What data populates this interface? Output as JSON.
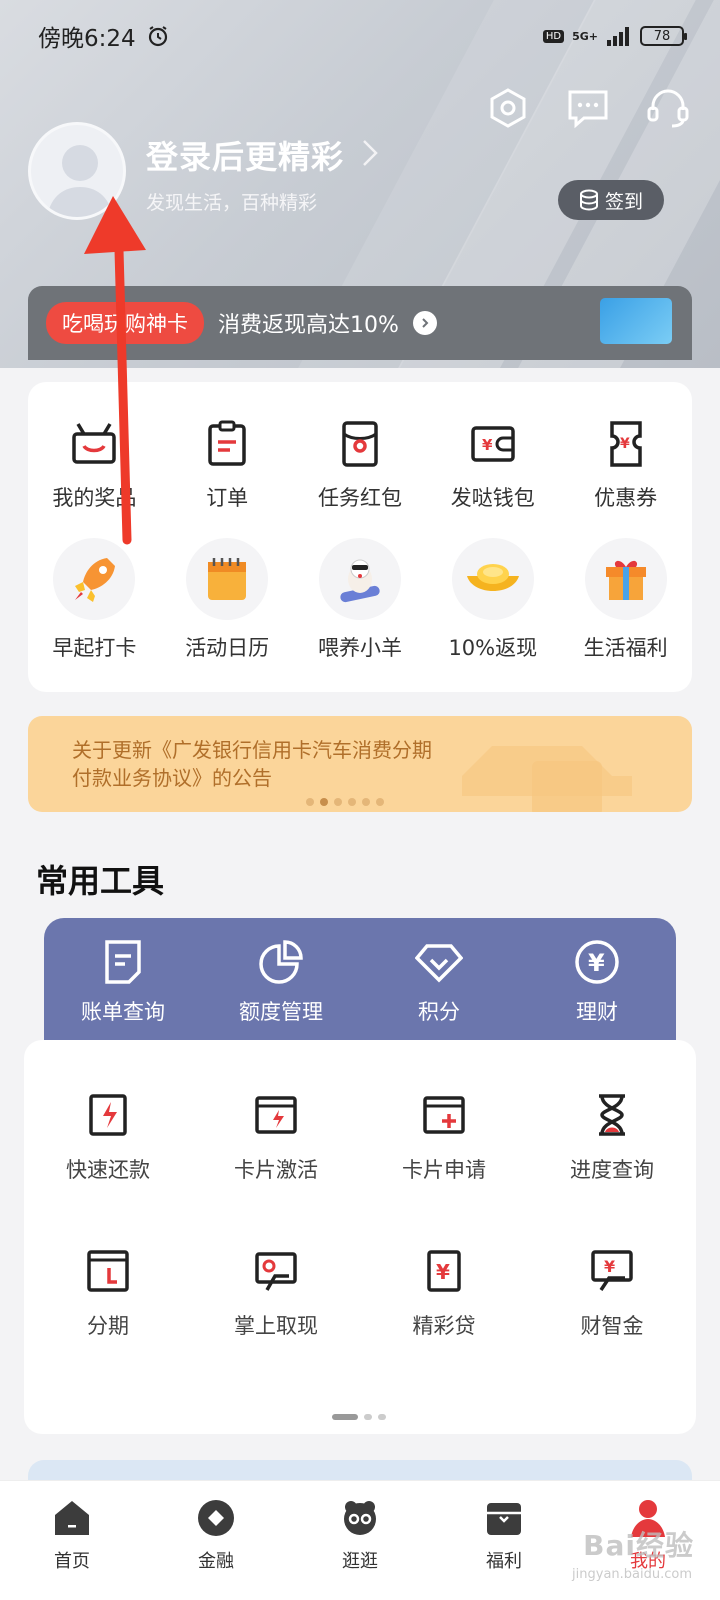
{
  "status_bar": {
    "time": "傍晚6:24",
    "hd": "HD",
    "network": "5G+",
    "battery": "78"
  },
  "header": {
    "login_title": "登录后更精彩",
    "login_subtitle": "发现生活，百种精彩",
    "checkin_label": "签到",
    "icons": [
      "settings-icon",
      "message-icon",
      "customer-service-icon"
    ]
  },
  "promo": {
    "tag": "吃喝玩购神卡",
    "text": "消费返现高达10%"
  },
  "quick_row1": [
    {
      "label": "我的奖品",
      "icon": "prize-basket-icon"
    },
    {
      "label": "订单",
      "icon": "order-clipboard-icon"
    },
    {
      "label": "任务红包",
      "icon": "red-envelope-icon"
    },
    {
      "label": "发哒钱包",
      "icon": "wallet-icon"
    },
    {
      "label": "优惠券",
      "icon": "coupon-icon"
    }
  ],
  "quick_row2": [
    {
      "label": "早起打卡",
      "icon": "rocket-icon"
    },
    {
      "label": "活动日历",
      "icon": "calendar-icon"
    },
    {
      "label": "喂养小羊",
      "icon": "sheep-icon"
    },
    {
      "label": "10%返现",
      "icon": "gold-ingot-icon"
    },
    {
      "label": "生活福利",
      "icon": "gift-box-icon"
    }
  ],
  "notice": {
    "text": "关于更新《广发银行信用卡汽车消费分期付款业务协议》的公告"
  },
  "tools_section": {
    "title": "常用工具",
    "strip": [
      {
        "label": "账单查询",
        "icon": "bill-icon"
      },
      {
        "label": "额度管理",
        "icon": "pie-chart-icon"
      },
      {
        "label": "积分",
        "icon": "diamond-icon"
      },
      {
        "label": "理财",
        "icon": "yen-coin-icon"
      }
    ],
    "row1": [
      {
        "label": "快速还款",
        "icon": "lightning-card-icon"
      },
      {
        "label": "卡片激活",
        "icon": "card-activate-icon"
      },
      {
        "label": "卡片申请",
        "icon": "card-apply-icon"
      },
      {
        "label": "进度查询",
        "icon": "hourglass-icon"
      }
    ],
    "row2": [
      {
        "label": "分期",
        "icon": "installment-icon"
      },
      {
        "label": "掌上取现",
        "icon": "cash-withdraw-icon"
      },
      {
        "label": "精彩贷",
        "icon": "loan-icon"
      },
      {
        "label": "财智金",
        "icon": "wealth-icon"
      }
    ]
  },
  "tabbar": [
    {
      "label": "首页",
      "icon": "home-icon"
    },
    {
      "label": "金融",
      "icon": "finance-icon"
    },
    {
      "label": "逛逛",
      "icon": "browse-icon"
    },
    {
      "label": "福利",
      "icon": "welfare-icon"
    },
    {
      "label": "我的",
      "icon": "profile-icon",
      "active": true
    }
  ],
  "watermark": {
    "text": "Bai经验",
    "sub": "jingyan.baidu.com"
  },
  "colors": {
    "accent": "#e4393c",
    "tools_strip": "#6b76ad",
    "notice_bg": "#fbd59a",
    "arrow": "#ee3a2a"
  }
}
